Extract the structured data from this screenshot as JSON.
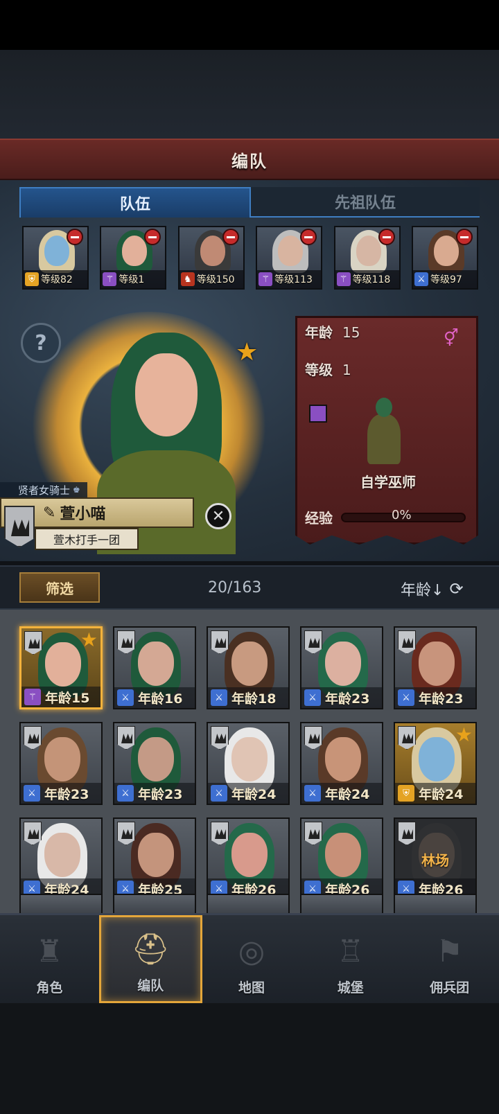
{
  "header": {
    "title": "编队"
  },
  "tabs": [
    {
      "label": "队伍",
      "active": true
    },
    {
      "label": "先祖队伍",
      "active": false
    }
  ],
  "team": [
    {
      "level": "等级82",
      "class": "shield-icon",
      "hair": "#d8c9a0",
      "face": "#7fb2d8"
    },
    {
      "level": "等级1",
      "class": "staff-icon",
      "hair": "#1f5a3b",
      "face": "#e2b09a"
    },
    {
      "level": "等级150",
      "class": "mount-icon",
      "hair": "#3a3a3a",
      "face": "#c08a74"
    },
    {
      "level": "等级113",
      "class": "staff-icon",
      "hair": "#bdbdbd",
      "face": "#d8b4a0"
    },
    {
      "level": "等级118",
      "class": "staff-icon",
      "hair": "#d9d4c4",
      "face": "#d6b6a4"
    },
    {
      "level": "等级97",
      "class": "sword-icon",
      "hair": "#5a3a28",
      "face": "#d9aa90"
    }
  ],
  "hero": {
    "subtitle": "贤者女骑士",
    "name": "萱小喵",
    "guild": "萱木打手一团",
    "age_label": "年龄",
    "age": "15",
    "level_label": "等级",
    "level": "1",
    "class_name": "自学巫师",
    "exp_label": "经验",
    "exp_text": "0%",
    "exp_fraction": 0
  },
  "filter": {
    "button": "筛选",
    "count": "20/163",
    "sort": "年龄↓"
  },
  "roster": [
    {
      "age": "年龄15",
      "class": "staff-icon",
      "hair": "#1f5a3b",
      "face": "#e2b09a",
      "selected": true,
      "star": true
    },
    {
      "age": "年龄16",
      "class": "sword-icon",
      "hair": "#1f5a3b",
      "face": "#d4a894"
    },
    {
      "age": "年龄18",
      "class": "sword-icon",
      "hair": "#4a3022",
      "face": "#c89a80"
    },
    {
      "age": "年龄23",
      "class": "sword-icon",
      "hair": "#24694a",
      "face": "#dcb0a0"
    },
    {
      "age": "年龄23",
      "class": "sword-icon",
      "hair": "#6a2a1e",
      "face": "#c8947c"
    },
    {
      "age": "年龄23",
      "class": "sword-icon",
      "hair": "#6a4a30",
      "face": "#c49478"
    },
    {
      "age": "年龄23",
      "class": "sword-icon",
      "hair": "#1f5a3b",
      "face": "#c49a86"
    },
    {
      "age": "年龄24",
      "class": "sword-icon",
      "hair": "#e8e8e8",
      "face": "#e0c4b4"
    },
    {
      "age": "年龄24",
      "class": "sword-icon",
      "hair": "#5a3a28",
      "face": "#c89478"
    },
    {
      "age": "年龄24",
      "class": "shield-icon",
      "hair": "#d8c9a0",
      "face": "#7fb2d8",
      "gold": true,
      "star": true
    },
    {
      "age": "年龄24",
      "class": "sword-icon",
      "hair": "#e8e8e8",
      "face": "#d8b8a8"
    },
    {
      "age": "年龄25",
      "class": "sword-icon",
      "hair": "#4a2a22",
      "face": "#c4947c"
    },
    {
      "age": "年龄26",
      "class": "sword-icon",
      "hair": "#24694a",
      "face": "#d89a8c"
    },
    {
      "age": "年龄26",
      "class": "sword-icon",
      "hair": "#24694a",
      "face": "#c89078"
    },
    {
      "age": "年龄26",
      "class": "sword-icon",
      "hair": "#3a3a3a",
      "face": "#8a7060",
      "dark": true,
      "location": "林场"
    }
  ],
  "nav": [
    {
      "label": "角色",
      "icon": "knight-icon",
      "active": false
    },
    {
      "label": "编队",
      "icon": "helmet-icon",
      "active": true
    },
    {
      "label": "地图",
      "icon": "compass-icon",
      "active": false
    },
    {
      "label": "城堡",
      "icon": "castle-icon",
      "active": false
    },
    {
      "label": "佣兵团",
      "icon": "banner-icon",
      "active": false
    }
  ],
  "colors": {
    "accent": "#e4a63a",
    "tab_blue": "#3f7ec2",
    "header_red": "#6a2a26"
  }
}
